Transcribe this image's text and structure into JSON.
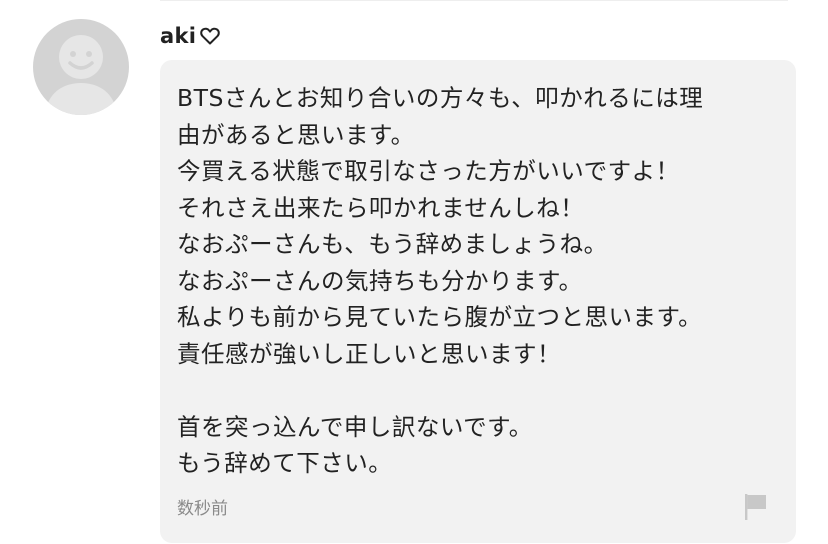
{
  "comment": {
    "username": "aki",
    "heart_icon": "heart-outline-icon",
    "avatar_icon": "default-user-avatar-icon",
    "body": "BTSさんとお知り合いの方々も、叩かれるには理\n由があると思います。\n今買える状態で取引なさった方がいいですよ！\nそれさえ出来たら叩かれませんしね！\nなおぷーさんも、もう辞めましょうね。\nなおぷーさんの気持ちも分かります。\n私よりも前から見ていたら腹が立つと思います。\n責任感が強いし正しいと思います！\n\n首を突っ込んで申し訳ないです。\nもう辞めて下さい。",
    "timestamp": "数秒前",
    "report_icon": "flag-icon"
  },
  "colors": {
    "bubble_background": "#f2f2f2",
    "avatar_background": "#d3d3d3",
    "avatar_figure": "#e6e6e6",
    "text": "#222222",
    "timestamp": "#8a8a8a",
    "flag": "#c8c8c8"
  }
}
